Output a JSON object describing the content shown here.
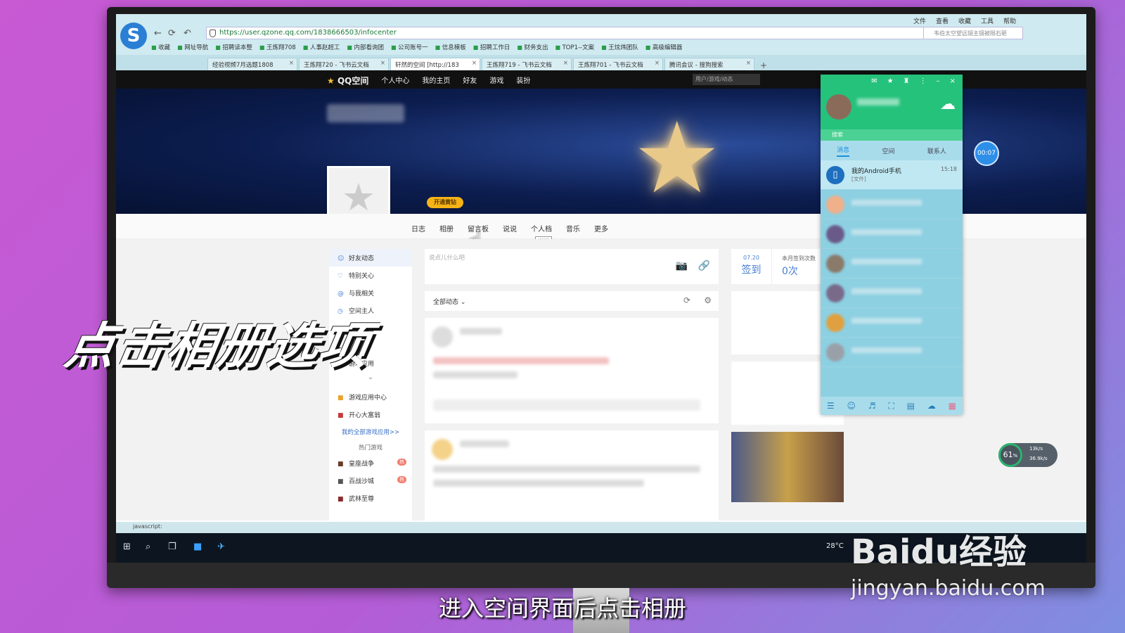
{
  "browser": {
    "address": "https://user.qzone.qq.com/1838666503/infocenter",
    "menu": [
      "文件",
      "查看",
      "收藏",
      "工具",
      "帮助"
    ],
    "search_placeholder": "韦伯太空望远镜主镜被陨石砸",
    "bookmarks": [
      "收藏",
      "网址导航",
      "招聘读本整",
      "王炼翔708",
      "人事赵超工",
      "内部看询团",
      "公司账号一",
      "信息模板",
      "招聘工作日",
      "财务支出",
      "TOP1--文案",
      "王炫炜团队",
      "高级编辑器"
    ],
    "tabs": [
      "经验视频7月选题1808",
      "王炼翔720 - 飞书云文档",
      "轩然的空间 [http://183",
      "王炼翔719 - 飞书云文档",
      "王炼翔701 - 飞书云文档",
      "腾讯会议 - 搜狗搜索"
    ],
    "status_text": "javascript:"
  },
  "qzone": {
    "nav": {
      "brand": "QQ空间",
      "items": [
        "个人中心",
        "我的主页",
        "好友",
        "游戏",
        "装扮"
      ],
      "search_placeholder": "用户/游戏/动态"
    },
    "vip_label": "开通黄钻",
    "tabs": [
      "日志",
      "相册",
      "留言板",
      "说说",
      "个人档",
      "音乐",
      "更多"
    ],
    "tooltip": "说说",
    "sidebar": {
      "items": [
        "好友动态",
        "特别关心",
        "与我相关",
        "空间主人",
        "游戏应用"
      ],
      "apps": [
        "游戏应用中心",
        "开心大富翁"
      ],
      "all_apps_link": "我的全部游戏应用>>",
      "hot_games_title": "热门游戏",
      "games": [
        "皇座战争",
        "百战沙城",
        "武林至尊"
      ]
    },
    "post_placeholder": "说点儿什么吧",
    "filter_label": "全部动态",
    "sign": {
      "date": "07.20",
      "label": "签到",
      "month_label": "本月签到次数",
      "count": "0次"
    }
  },
  "qq_panel": {
    "search_placeholder": "搜索",
    "tabs": [
      "消息",
      "空间",
      "联系人"
    ],
    "first_contact": {
      "name": "我的Android手机",
      "sub": "[文件]",
      "time": "15:18"
    }
  },
  "timer": "00:07",
  "speed": {
    "percent": "61",
    "unit": "%",
    "up": "13k/s",
    "down": "36.9k/s"
  },
  "taskbar": {
    "temperature": "28°C"
  },
  "overlay_title": "点击相册选项",
  "caption": "进入空间界面后点击相册",
  "watermark": {
    "brand": "Baidu经验",
    "url": "jingyan.baidu.com"
  }
}
